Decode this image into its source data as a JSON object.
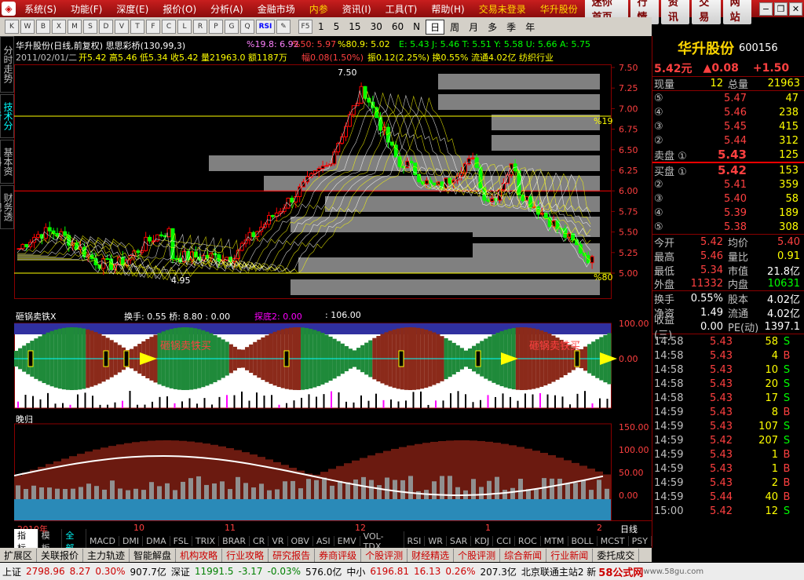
{
  "menu": {
    "items": [
      "系统(S)",
      "功能(F)",
      "深度(E)",
      "报价(O)",
      "分析(A)",
      "金融市场",
      "内参",
      "资讯(I)",
      "工具(T)",
      "帮助(H)",
      "交易未登录",
      "华升股份"
    ],
    "nav": [
      "迷你首页",
      "行情",
      "资讯",
      "交易",
      "网站"
    ]
  },
  "toolbar": {
    "periods": [
      "1",
      "5",
      "15",
      "30",
      "60",
      "N",
      "日",
      "周",
      "月",
      "多",
      "季",
      "年"
    ],
    "active_period": "日",
    "btns": [
      "K",
      "W",
      "B",
      "X",
      "M",
      "S",
      "D",
      "V",
      "T",
      "F",
      "C",
      "L",
      "R",
      "P",
      "G",
      "Q",
      "RSI"
    ]
  },
  "side_tabs": [
    "分时走势",
    "技术分析",
    "基本资料",
    "财务透视"
  ],
  "chart": {
    "header1": "华升股份(日线,前复权) 思思彩桥(130,99,3)",
    "pct1": "%19.8: 6.92",
    "pct2": "%50: 5.97",
    "pct3": "%80.9: 5.02",
    "e_j": "E: 5.43  J: 5.46  T: 5.51  Y: 5.58  U: 5.66  A: 5.75",
    "header2_date": "2011/02/01/二",
    "header2_ohlc": "开5.42 高5.46 低5.34 收5.42 量21963.0 额1187万",
    "header2_fu": "幅0.08(1.50%)",
    "header2_rest": "振0.12(2.25%) 换0.55% 流通4.02亿 纺织行业",
    "y_ticks": [
      "7.50",
      "7.25",
      "7.00",
      "6.75",
      "6.50",
      "6.25",
      "6.00",
      "5.75",
      "5.50",
      "5.25",
      "5.00"
    ],
    "high_marker": "7.50",
    "low_marker": "4.95",
    "pct19_label": "%19",
    "pct80_label": "%80",
    "ind1_title": "砸锅卖铁X",
    "ind1_vals": "换手: 0.55  桥: 8.80  : 0.00",
    "ind1_tan": "探底2: 0.00",
    "ind1_106": ": 106.00",
    "ind1_ticks": [
      "100.00",
      "0.00"
    ],
    "ind1_annot": "砸锅卖铁买",
    "ind2_title": "晚归",
    "ind2_ticks": [
      "150.00",
      "100.00",
      "50.00",
      "0.00"
    ],
    "x_labels": [
      "2010年",
      "10",
      "11",
      "12",
      "1",
      "2"
    ],
    "x_period": "日线"
  },
  "ind_tabs": [
    "指标",
    "模板",
    "全部",
    "MACD",
    "DMI",
    "DMA",
    "FSL",
    "TRIX",
    "BRAR",
    "CR",
    "VR",
    "OBV",
    "ASI",
    "EMV",
    "VOL-TDX",
    "RSI",
    "WR",
    "SAR",
    "KDJ",
    "CCI",
    "ROC",
    "MTM",
    "BOLL",
    "MCST",
    "PSY"
  ],
  "bottom_tabs": [
    "扩展区",
    "关联报价",
    "主力轨迹",
    "智能解盘",
    "机构攻略",
    "行业攻略",
    "研究报告",
    "券商评级",
    "个股评测",
    "财经精选",
    "个股评测",
    "综合新闻",
    "行业新闻",
    "委托成交"
  ],
  "quote": {
    "name": "华升股份",
    "code": "600156",
    "price": "5.42元",
    "chg": "▲0.08",
    "chg2": "+1.50",
    "xianliang_lbl": "现量",
    "xianliang": "12",
    "zongliang_lbl": "总量",
    "zongliang": "21963",
    "sells": [
      {
        "lbl": "⑤",
        "price": "5.47",
        "vol": "47"
      },
      {
        "lbl": "④",
        "price": "5.46",
        "vol": "238"
      },
      {
        "lbl": "③",
        "price": "5.45",
        "vol": "415"
      },
      {
        "lbl": "②",
        "price": "5.44",
        "vol": "312"
      },
      {
        "lbl": "卖盘 ①",
        "price": "5.43",
        "vol": "125"
      }
    ],
    "buys": [
      {
        "lbl": "买盘 ①",
        "price": "5.42",
        "vol": "153"
      },
      {
        "lbl": "②",
        "price": "5.41",
        "vol": "359"
      },
      {
        "lbl": "③",
        "price": "5.40",
        "vol": "58"
      },
      {
        "lbl": "④",
        "price": "5.39",
        "vol": "189"
      },
      {
        "lbl": "⑤",
        "price": "5.38",
        "vol": "308"
      }
    ],
    "stats": [
      {
        "l1": "今开",
        "v1": "5.42",
        "l2": "均价",
        "v2": "5.40"
      },
      {
        "l1": "最高",
        "v1": "5.46",
        "l2": "量比",
        "v2": "0.91"
      },
      {
        "l1": "最低",
        "v1": "5.34",
        "l2": "市值",
        "v2": "21.8亿"
      },
      {
        "l1": "外盘",
        "v1": "11332",
        "l2": "内盘",
        "v2": "10631"
      },
      {
        "l1": "换手",
        "v1": "0.55%",
        "l2": "股本",
        "v2": "4.02亿"
      },
      {
        "l1": "净资",
        "v1": "1.49",
        "l2": "流通",
        "v2": "4.02亿"
      },
      {
        "l1": "收益(三)",
        "v1": "0.00",
        "l2": "PE(动)",
        "v2": "1397.1"
      }
    ],
    "ticks": [
      {
        "t": "14:58",
        "p": "5.43",
        "v": "58",
        "d": "S"
      },
      {
        "t": "14:58",
        "p": "5.43",
        "v": "4",
        "d": "B"
      },
      {
        "t": "14:58",
        "p": "5.43",
        "v": "10",
        "d": "S"
      },
      {
        "t": "14:58",
        "p": "5.43",
        "v": "20",
        "d": "S"
      },
      {
        "t": "14:58",
        "p": "5.43",
        "v": "17",
        "d": "S"
      },
      {
        "t": "14:59",
        "p": "5.43",
        "v": "8",
        "d": "B"
      },
      {
        "t": "14:59",
        "p": "5.43",
        "v": "107",
        "d": "S"
      },
      {
        "t": "14:59",
        "p": "5.42",
        "v": "207",
        "d": "S"
      },
      {
        "t": "14:59",
        "p": "5.43",
        "v": "1",
        "d": "B"
      },
      {
        "t": "14:59",
        "p": "5.43",
        "v": "1",
        "d": "B"
      },
      {
        "t": "14:59",
        "p": "5.43",
        "v": "2",
        "d": "B"
      },
      {
        "t": "14:59",
        "p": "5.44",
        "v": "40",
        "d": "B"
      },
      {
        "t": "15:00",
        "p": "5.42",
        "v": "12",
        "d": "S"
      }
    ]
  },
  "status": {
    "sh_lbl": "上证",
    "sh": "2798.96",
    "sh_c": "8.27",
    "sh_p": "0.30%",
    "sh_a": "907.7亿",
    "sz_lbl": "深证",
    "sz": "11991.5",
    "sz_c": "-3.17",
    "sz_p": "-0.03%",
    "sz_a": "576.0亿",
    "zx_lbl": "中小",
    "zx": "6196.81",
    "zx_c": "16.13",
    "zx_p": "0.26%",
    "zx_a": "207.3亿",
    "server": "北京联通主站2 新",
    "brand": "58公式网",
    "url": "www.58gu.com"
  },
  "colors": {
    "up": "#ff0000",
    "down": "#00ff00",
    "accent": "#ffd700",
    "bg": "#000000"
  }
}
